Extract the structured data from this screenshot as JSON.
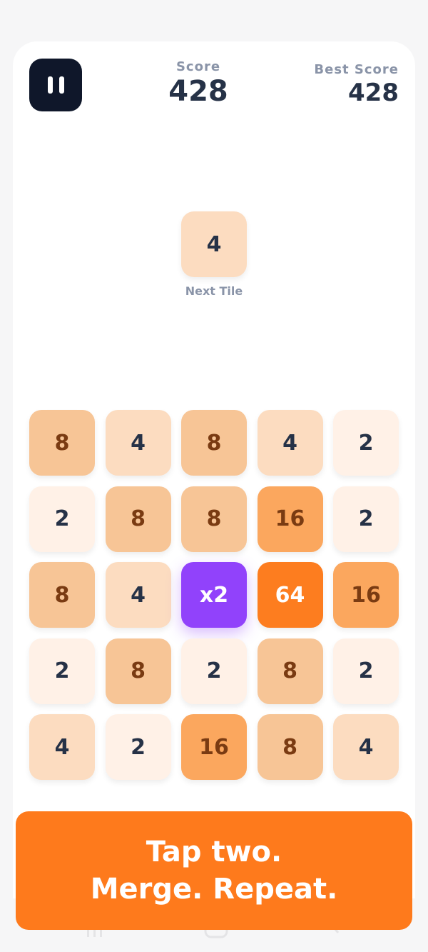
{
  "header": {
    "score_label": "Score",
    "score_value": "428",
    "best_label": "Best Score",
    "best_value": "428"
  },
  "next_tile": {
    "value": "4",
    "label": "Next Tile"
  },
  "board": {
    "rows": [
      [
        "8",
        "4",
        "8",
        "4",
        "2"
      ],
      [
        "2",
        "8",
        "8",
        "16",
        "2"
      ],
      [
        "8",
        "4",
        "x2",
        "64",
        "16"
      ],
      [
        "2",
        "8",
        "2",
        "8",
        "2"
      ],
      [
        "4",
        "2",
        "16",
        "8",
        "4"
      ]
    ]
  },
  "banner": {
    "line1": "Tap two.",
    "line2": "Merge. Repeat."
  },
  "colors": {
    "accent": "#fe7a1c",
    "multiplier": "#9142fb",
    "pause_button": "#0f172a"
  }
}
